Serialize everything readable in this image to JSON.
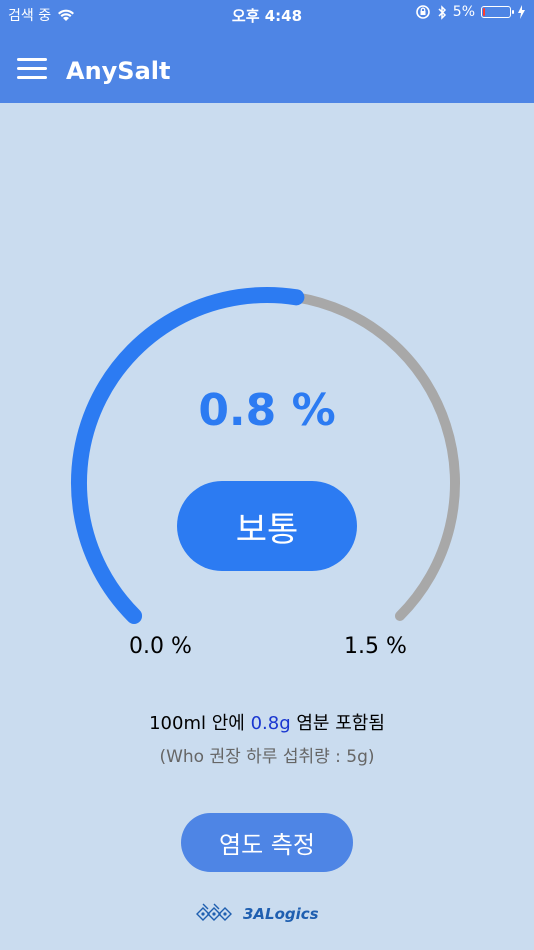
{
  "status_bar": {
    "carrier": "검색 중",
    "time": "오후 4:48",
    "battery_percent": "5%",
    "battery_level": 0.05
  },
  "app_bar": {
    "title": "AnySalt"
  },
  "gauge": {
    "value_text": "0.8 %",
    "value": 0.8,
    "min": 0.0,
    "max": 1.5,
    "min_label": "0.0 %",
    "max_label": "1.5 %",
    "status_label": "보통",
    "colors": {
      "fill": "#2c7bf2",
      "track": "#a8a8a8"
    }
  },
  "info": {
    "prefix": "100ml 안에 ",
    "amount": "0.8g",
    "suffix": " 염분 포함됨",
    "who_note": "(Who 권장 하루 섭취량 : 5g)"
  },
  "actions": {
    "measure_label": "염도 측정"
  },
  "footer": {
    "logo_text": "3ALogics"
  }
}
